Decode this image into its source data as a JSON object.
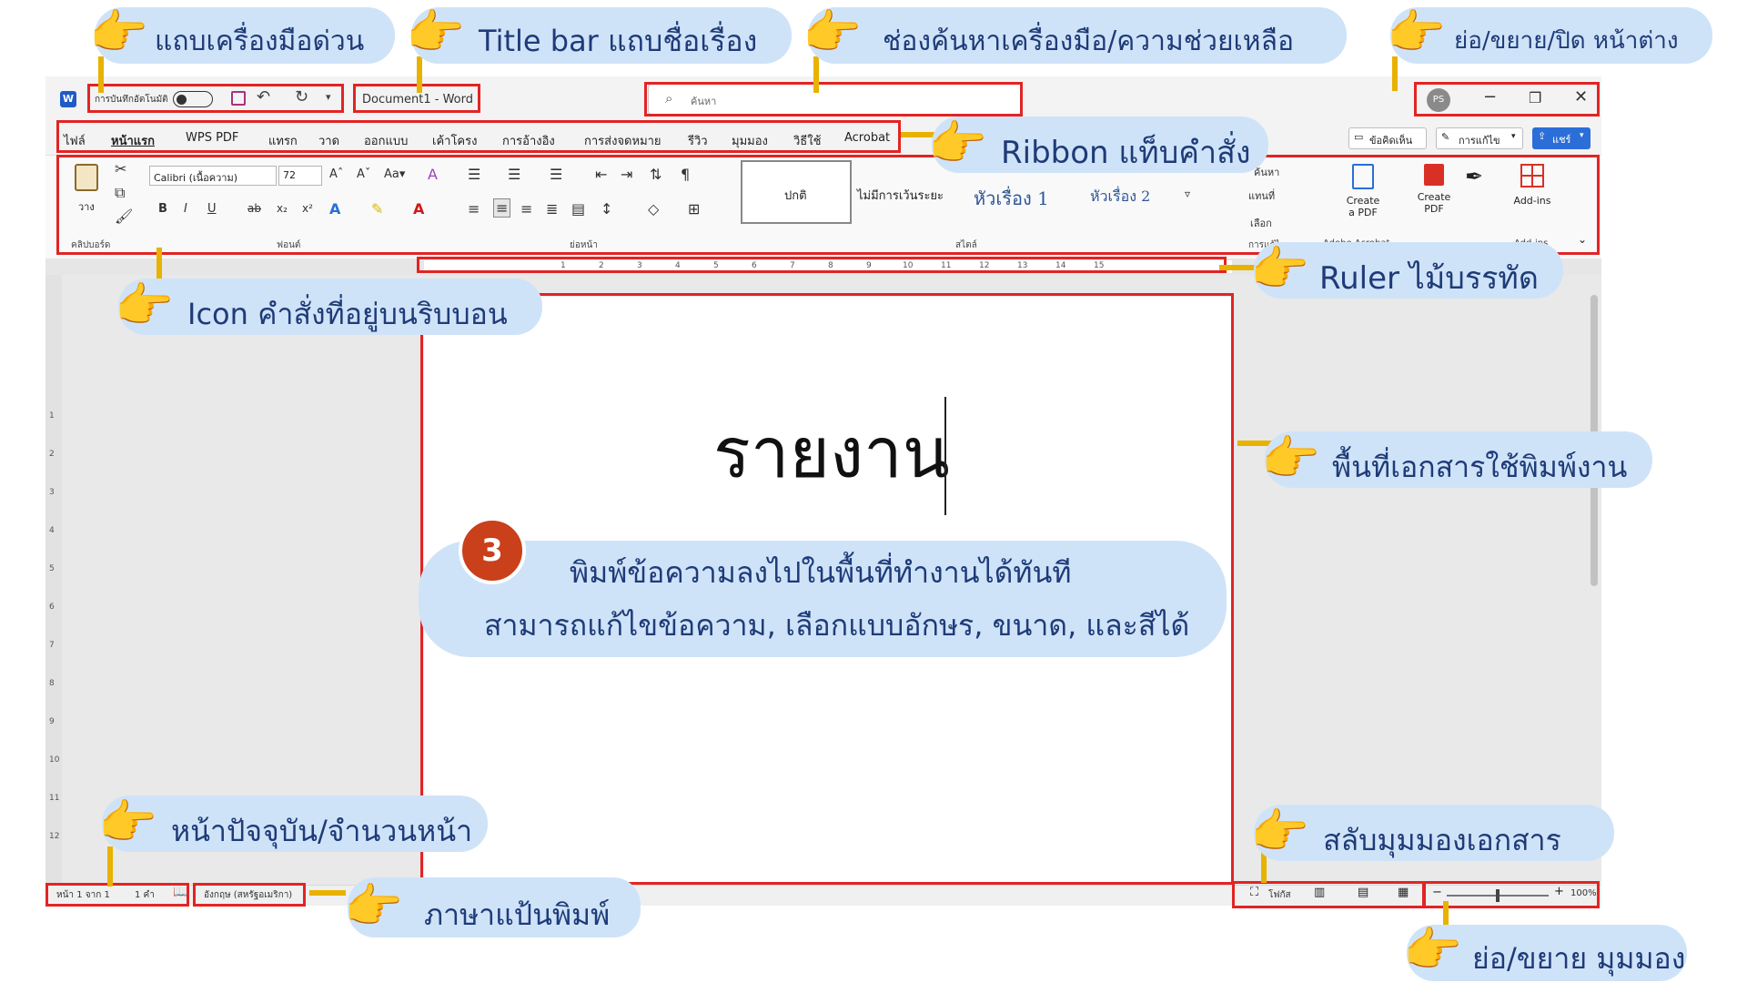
{
  "window": {
    "autosave_label": "การบันทึกอัตโนมัติ",
    "doc_title": "Document1  -  Word",
    "search_placeholder": "ค้นหา",
    "avatar": "PS",
    "minimize": "−",
    "restore": "❐",
    "close": "✕"
  },
  "tabs": [
    "ไฟล์",
    "หน้าแรก",
    "WPS PDF",
    "แทรก",
    "วาด",
    "ออกแบบ",
    "เค้าโครง",
    "การอ้างอิง",
    "การส่งจดหมาย",
    "รีวิว",
    "มุมมอง",
    "วิธีใช้",
    "Acrobat"
  ],
  "ribbon_right": {
    "comments": "ข้อคิดเห็น",
    "editing": "การแก้ไข",
    "share": "แชร์"
  },
  "ribbon": {
    "paste_label": "วาง",
    "font_name": "Calibri (เนื้อความ)",
    "font_size": "72",
    "styles": [
      "ปกติ",
      "ไม่มีการเว้นระยะ",
      "หัวเรื่อง 1",
      "หัวเรื่อง 2"
    ],
    "groups": [
      "คลิปบอร์ด",
      "ฟอนต์",
      "ย่อหน้า",
      "สไตล์",
      "การแก้ไข",
      "Adobe Acrobat",
      "Add-ins"
    ],
    "find_label": "ค้นหา",
    "replace_label": "แทนที่",
    "select_label": "เลือก",
    "create_share": [
      "Create",
      "a PDF"
    ],
    "create_pdf": [
      "Create",
      "PDF"
    ],
    "addins": "Add-ins"
  },
  "ruler_numbers": [
    "1",
    "2",
    "3",
    "4",
    "5",
    "6",
    "7",
    "8",
    "9",
    "10",
    "11",
    "12",
    "13",
    "14",
    "15"
  ],
  "vruler_numbers": [
    "1",
    "2",
    "3",
    "4",
    "5",
    "6",
    "7",
    "8",
    "9",
    "10",
    "11",
    "12"
  ],
  "document": {
    "text": "รายงาน"
  },
  "status": {
    "page": "หน้า 1 จาก 1",
    "words": "1 คำ",
    "language": "อังกฤษ (สหรัฐอเมริกา)",
    "focus": "โฟกัส",
    "zoom": "100%"
  },
  "callouts": {
    "quick_access": "แถบเครื่องมือด่วน",
    "title_bar": "Title bar แถบชื่อเรื่อง",
    "search": "ช่องค้นหาเครื่องมือ/ความช่วยเหลือ",
    "window_controls": "ย่อ/ขยาย/ปิด หน้าต่าง",
    "ribbon": "Ribbon แท็บคำสั่ง",
    "ruler": "Ruler ไม้บรรทัด",
    "icons": "Icon คำสั่งที่อยู่บนริบบอน",
    "document_area": "พื้นที่เอกสารใช้พิมพ์งาน",
    "step_number": "3",
    "step_line1": "พิมพ์ข้อความลงไปในพื้นที่ทำงานได้ทันที",
    "step_line2": "สามารถแก้ไขข้อความ, เลือกแบบอักษร, ขนาด, และสีได้",
    "page_count": "หน้าปัจจุบัน/จำนวนหน้า",
    "views": "สลับมุมมองเอกสาร",
    "keyboard_lang": "ภาษาแป้นพิมพ์",
    "zoom": "ย่อ/ขยาย มุมมอง"
  },
  "colors": {
    "accent": "#e22424",
    "callout_bg": "#cfe3f8",
    "callout_text": "#1f3b78",
    "share_blue": "#2b6ed8",
    "step_badge": "#c9401a"
  },
  "icons": [
    "word-logo-icon",
    "save-icon",
    "undo-icon",
    "redo-icon",
    "search-icon",
    "comment-icon",
    "pencil-icon",
    "share-icon",
    "hand-pointer-icon"
  ]
}
